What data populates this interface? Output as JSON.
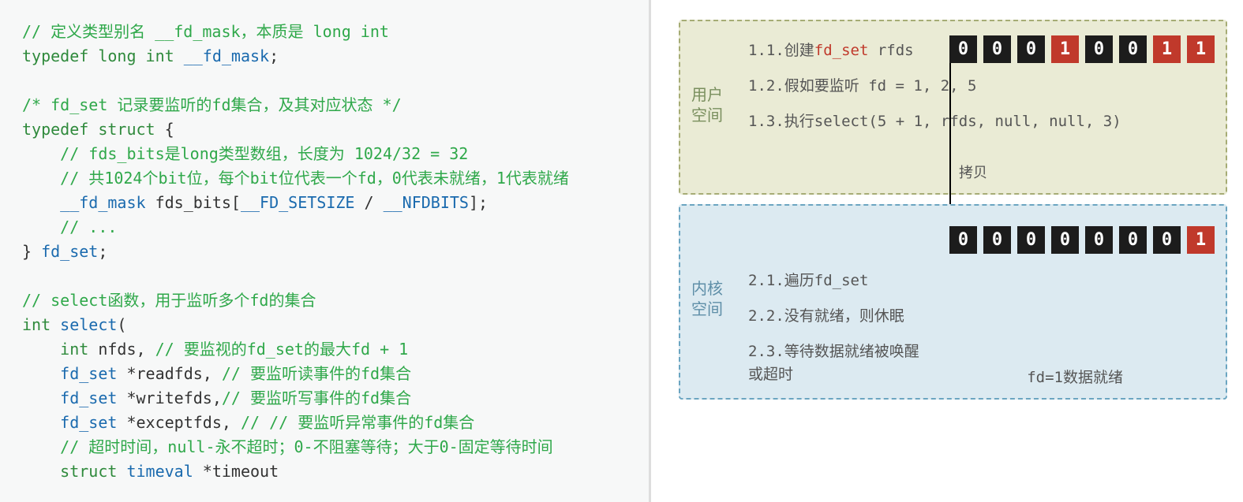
{
  "code": {
    "l1": "// 定义类型别名 __fd_mask，本质是 long int",
    "l2a": "typedef",
    "l2b": "long int",
    "l2c": "__fd_mask",
    "l2d": ";",
    "l4": "/* fd_set 记录要监听的fd集合，及其对应状态 */",
    "l5a": "typedef",
    "l5b": "struct",
    "l5c": " {",
    "l6": "    // fds_bits是long类型数组，长度为 1024/32 = 32",
    "l7": "    // 共1024个bit位，每个bit位代表一个fd，0代表未就绪，1代表就绪",
    "l8a": "    __fd_mask",
    "l8b": " fds_bits[",
    "l8c": "__FD_SETSIZE",
    "l8d": " / ",
    "l8e": "__NFDBITS",
    "l8f": "];",
    "l9": "    // ...",
    "l10a": "} ",
    "l10b": "fd_set",
    "l10c": ";",
    "l12": "// select函数，用于监听多个fd的集合",
    "l13a": "int",
    "l13b": "select",
    "l13c": "(",
    "l14a": "    int",
    "l14b": " nfds, ",
    "l14c": "// 要监视的fd_set的最大fd + 1",
    "l15a": "    fd_set",
    "l15b": " *readfds, ",
    "l15c": "// 要监听读事件的fd集合",
    "l16a": "    fd_set",
    "l16b": " *writefds,",
    "l16c": "// 要监听写事件的fd集合",
    "l17a": "    fd_set",
    "l17b": " *exceptfds, ",
    "l17c": "// // 要监听异常事件的fd集合",
    "l18": "    // 超时时间，null-永不超时；0-不阻塞等待；大于0-固定等待时间",
    "l19a": "    struct",
    "l19b": "timeval",
    "l19c": " *timeout"
  },
  "diagram": {
    "user_label_l1": "用户",
    "user_label_l2": "空间",
    "kernel_label_l1": "内核",
    "kernel_label_l2": "空间",
    "step11a": "1.1.创建",
    "step11b": "fd_set",
    "step11c": " rfds",
    "step12": "1.2.假如要监听 fd = 1, 2, 5",
    "step13": "1.3.执行select(5 + 1, rfds, null, null, 3)",
    "copy": "拷贝",
    "step21": "2.1.遍历fd_set",
    "step22": "2.2.没有就绪，则休眠",
    "step23a": "2.3.等待数据就绪被唤醒",
    "step23b": "或超时",
    "ready": "fd=1数据就绪",
    "user_bits": [
      "0",
      "0",
      "0",
      "1",
      "0",
      "0",
      "1",
      "1"
    ],
    "kernel_bits": [
      "0",
      "0",
      "0",
      "0",
      "0",
      "0",
      "0",
      "1"
    ]
  }
}
